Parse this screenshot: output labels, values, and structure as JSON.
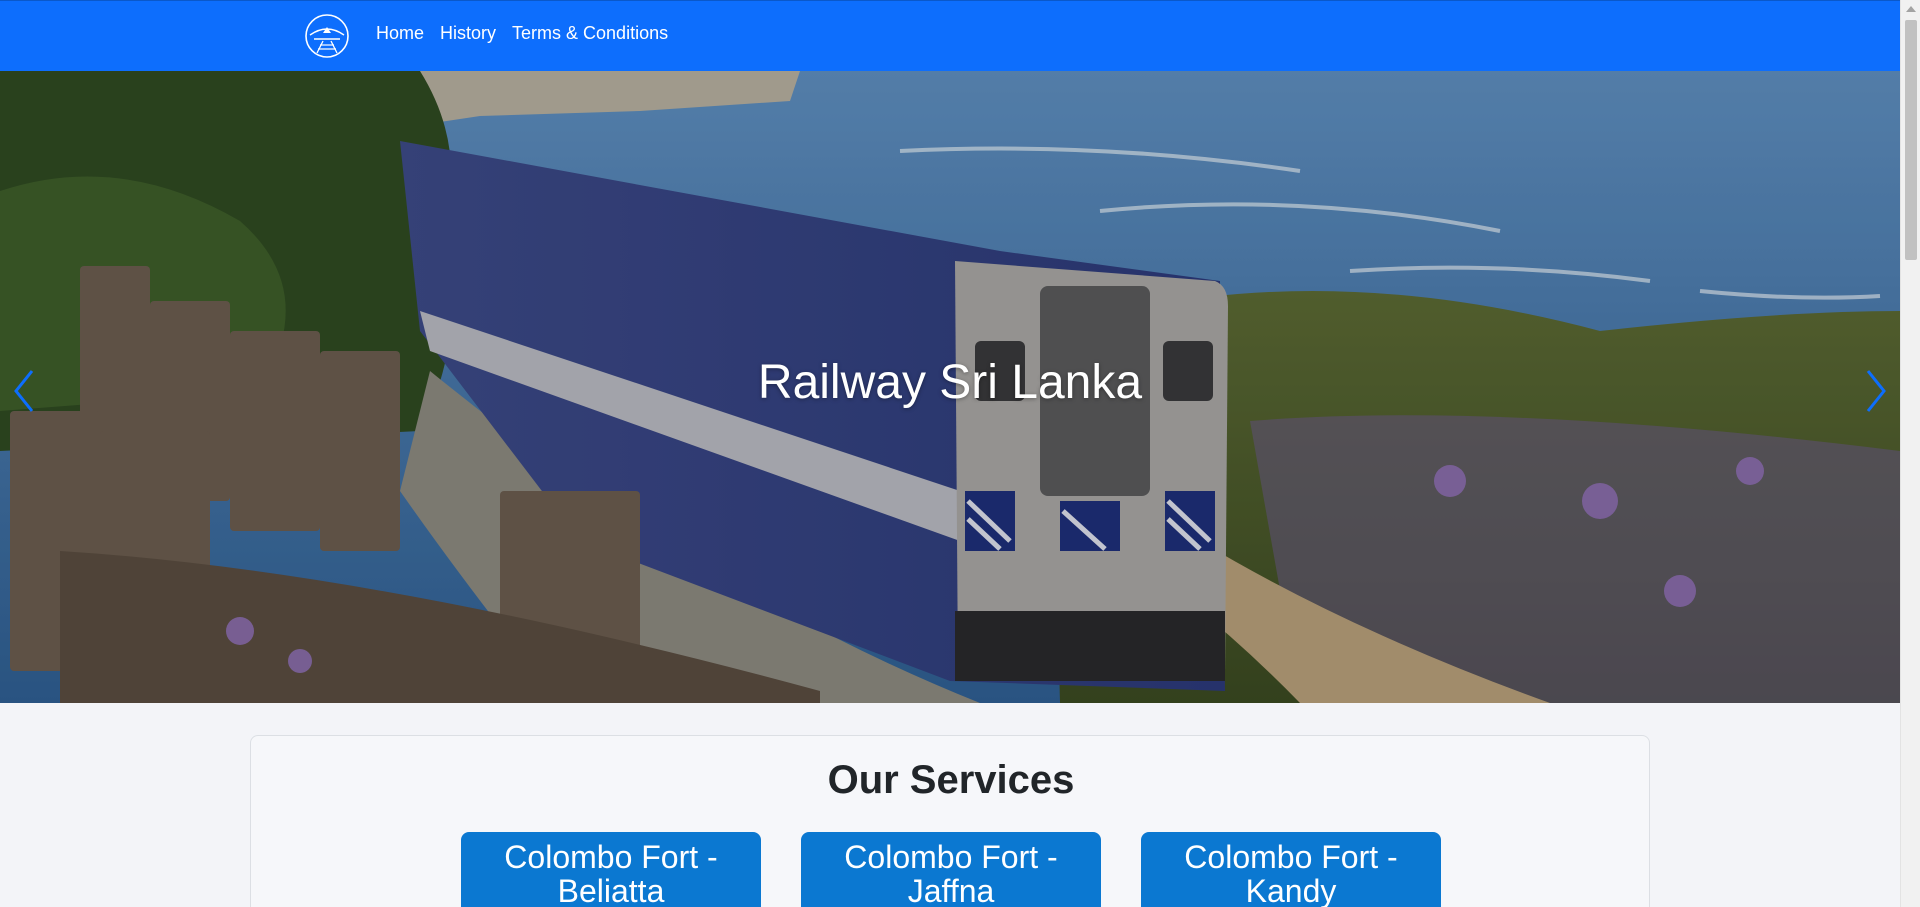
{
  "nav": {
    "logo_icon": "railway-logo-icon",
    "links": [
      {
        "label": "Home"
      },
      {
        "label": "History"
      },
      {
        "label": "Terms & Conditions"
      }
    ],
    "bg_color": "#0d6efd"
  },
  "hero": {
    "caption": "Railway Sri Lanka",
    "prev_icon": "chevron-left-icon",
    "next_icon": "chevron-right-icon"
  },
  "services": {
    "title": "Our Services",
    "routes": [
      {
        "label": "Colombo Fort - Beliatta"
      },
      {
        "label": "Colombo Fort - Jaffna"
      },
      {
        "label": "Colombo Fort - Kandy"
      }
    ],
    "button_color": "#0b78d1"
  }
}
